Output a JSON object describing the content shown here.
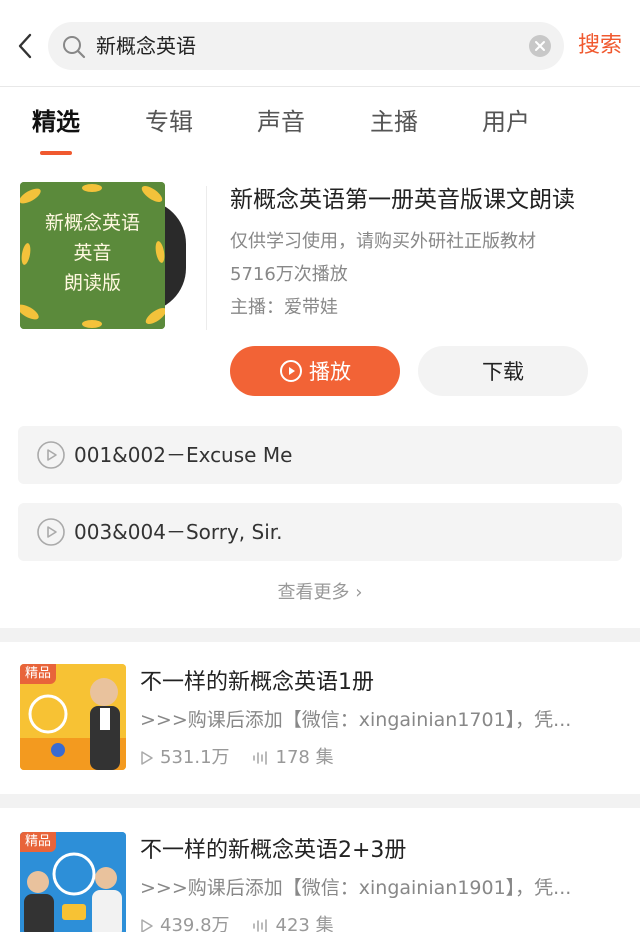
{
  "header": {
    "query": "新概念英语",
    "search_label": "搜索"
  },
  "tabs": [
    {
      "label": "精选",
      "active": true
    },
    {
      "label": "专辑",
      "active": false
    },
    {
      "label": "声音",
      "active": false
    },
    {
      "label": "主播",
      "active": false
    },
    {
      "label": "用户",
      "active": false
    }
  ],
  "album": {
    "cover_text": [
      "新概念英语",
      "英音",
      "朗读版"
    ],
    "title": "新概念英语第一册英音版课文朗读",
    "note": "仅供学习使用，请购买外研社正版教材",
    "plays": "5716万次播放",
    "host": "主播：爱带娃",
    "play_label": "播放",
    "download_label": "下载"
  },
  "tracks": [
    {
      "title": "001&002－Excuse Me"
    },
    {
      "title": "003&004－Sorry, Sir."
    }
  ],
  "more_label": "查看更多 ›",
  "results": [
    {
      "badge": "精品",
      "title": "不一样的新概念英语1册",
      "desc": ">>>购课后添加【微信：xingainian1701】，凭...",
      "plays": "531.1万",
      "episodes": "178 集",
      "cover_color": "#f7c234"
    },
    {
      "badge": "精品",
      "title": "不一样的新概念英语2+3册",
      "desc": ">>>购课后添加【微信：xingainian1901】，凭...",
      "plays": "439.8万",
      "episodes": "423 集",
      "cover_color": "#2d8fd8"
    }
  ],
  "colors": {
    "accent": "#f0592f",
    "play_button": "#f26336"
  }
}
